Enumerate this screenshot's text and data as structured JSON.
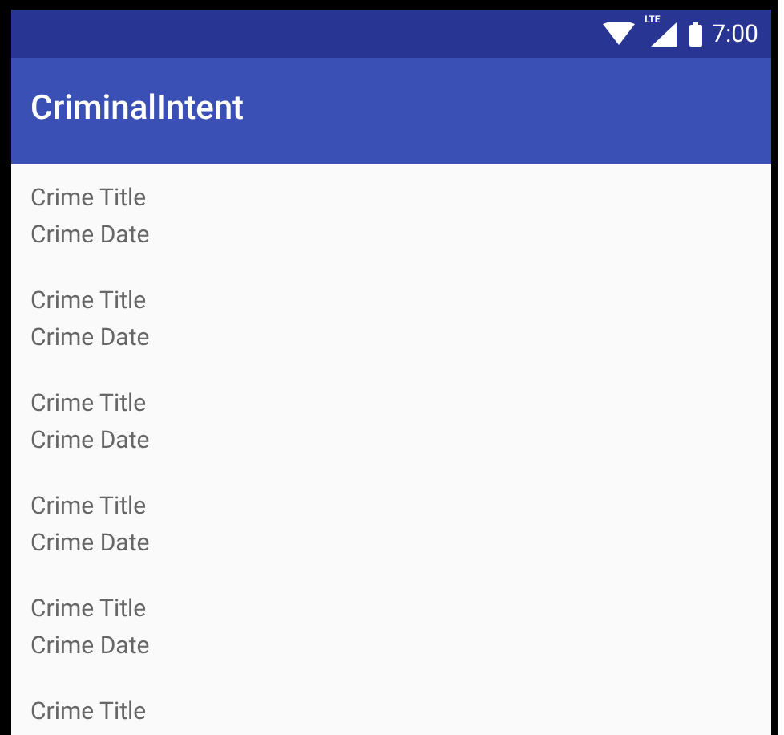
{
  "status_bar": {
    "time": "7:00",
    "network_label": "LTE"
  },
  "app_bar": {
    "title": "CriminalIntent"
  },
  "crimes": [
    {
      "title": "Crime Title",
      "date": "Crime Date"
    },
    {
      "title": "Crime Title",
      "date": "Crime Date"
    },
    {
      "title": "Crime Title",
      "date": "Crime Date"
    },
    {
      "title": "Crime Title",
      "date": "Crime Date"
    },
    {
      "title": "Crime Title",
      "date": "Crime Date"
    },
    {
      "title": "Crime Title"
    }
  ]
}
